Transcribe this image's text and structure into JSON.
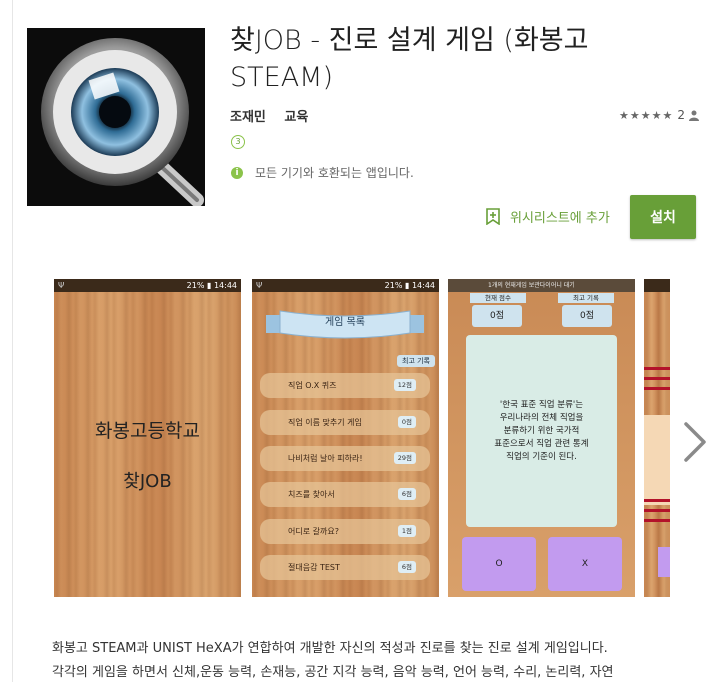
{
  "app": {
    "title_line1": "찾JOB - 진로 설계 게임 (화봉고",
    "title_line2": "STEAM)",
    "developer": "조재민",
    "category": "교육",
    "rating_count": "2",
    "age_rating": "3",
    "compatibility": "모든 기기와 호환되는 앱입니다.",
    "wishlist_label": "위시리스트에 추가",
    "install_label": "설치",
    "accent_color": "#689f38"
  },
  "screenshots": {
    "s1": {
      "time": "14:44",
      "status_glyphs": "Ψ",
      "battery": "21%",
      "school": "화봉고등학교",
      "game_name": "찾JOB"
    },
    "s2": {
      "time": "14:44",
      "status_glyphs": "Ψ",
      "battery": "21%",
      "menu_title": "게임 목록",
      "best_record_label": "최고 기록",
      "items": [
        {
          "label": "직업 O.X 퀴즈",
          "score": "12점"
        },
        {
          "label": "직업 이름 맞추기 게임",
          "score": "0점"
        },
        {
          "label": "나비처럼 날아 피하라!",
          "score": "29점"
        },
        {
          "label": "치즈를 찾아서",
          "score": "6점"
        },
        {
          "label": "어디로 갈까요?",
          "score": "1점"
        },
        {
          "label": "절대음감 TEST",
          "score": "6점"
        }
      ]
    },
    "s3": {
      "notice": "1개의 현재게임 보관다이어니 대기",
      "current_score_label": "현재 점수",
      "best_score_label": "최고 기록",
      "current_score": "0점",
      "best_score": "0점",
      "quiz_lines": [
        "'한국 표준 직업 분류'는",
        "우리나라의 전체 직업을",
        "분류하기 위한 국가적",
        "표준으로서 직업 관련 통계",
        "직업의 기준이 된다."
      ],
      "answer_o": "O",
      "answer_x": "X"
    }
  },
  "description": {
    "line1": "화봉고 STEAM과 UNIST HeXA가 연합하여 개발한 자신의 적성과 진로를 찾는 진로 설계 게임입니다.",
    "line2": "각각의 게임을 하면서 신체,운동 능력, 손재능, 공간 지각 능력, 음악 능력, 언어 능력, 수리, 논리력, 자연"
  }
}
